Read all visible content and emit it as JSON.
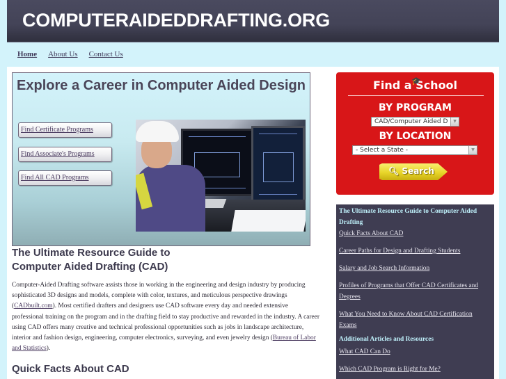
{
  "site": {
    "title": "COMPUTERAIDEDDRAFTING.ORG"
  },
  "nav": {
    "items": [
      {
        "label": "Home",
        "active": true
      },
      {
        "label": "About Us",
        "active": false
      },
      {
        "label": "Contact Us",
        "active": false
      }
    ]
  },
  "hero": {
    "title": "Explore a Career in Computer Aided Design",
    "buttons": [
      {
        "label": "Find Certificate Programs"
      },
      {
        "label": "Find Associate's Programs"
      },
      {
        "label": "Find All CAD Programs"
      }
    ],
    "photo_alt": "CAD drafter wearing hard hat working at dual monitors"
  },
  "main": {
    "section_title": "The Ultimate Resource Guide to Computer Aided Drafting (CAD)",
    "section_title_line1": "The Ultimate Resource Guide to",
    "section_title_line2": "Computer Aided Drafting (CAD)",
    "paragraph": {
      "part1": "Computer-Aided Drafting software assists those in working in the engineering and design industry by producing sophisticated 3D designs and models, complete with color, textures, and meticulous perspective drawings (",
      "link1": "CADbuilt.com",
      "part2": "). Most certified drafters and designers use CAD software every day and needed extensive professional training on the program and in the drafting field to stay productive and rewarded in the industry. A career using CAD offers many creative and technical professional opportunities such as jobs in landscape architecture, interior and fashion design, engineering, computer electronics, surveying, and even jewelry design (",
      "link2": "Bureau of Labor and Statistics",
      "part3": ")."
    },
    "next_section_title": "Quick Facts About CAD"
  },
  "find_school": {
    "title": "Find a School",
    "by_program_label": "BY PROGRAM",
    "program_selected": "CAD/Computer Aided D",
    "by_location_label": "BY LOCATION",
    "state_selected": "- Select a State -",
    "search_label": "Search",
    "colors": {
      "background": "#d81618",
      "button": "#e8d52a"
    }
  },
  "sidebar": {
    "heading1": "The Ultimate Resource Guide to Computer Aided Drafting",
    "links1": [
      "Quick Facts About CAD",
      "Career Paths for Design and Drafting Students",
      "Salary and Job Search Information",
      "Profiles of Programs that Offer CAD Certificates and Degrees",
      "What You Need to Know About CAD Certification Exams"
    ],
    "heading2": "Additional Articles and Resources",
    "links2": [
      "What CAD Can Do",
      "Which CAD Program is Right for Me?"
    ]
  }
}
